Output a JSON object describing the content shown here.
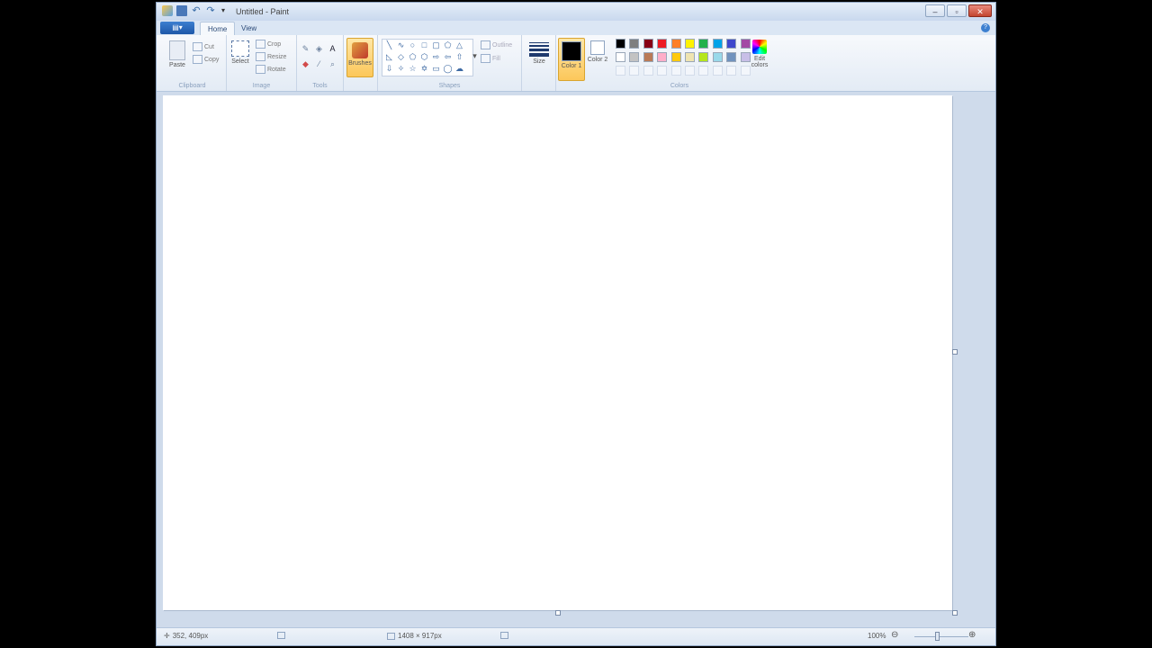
{
  "window": {
    "title": "Untitled - Paint",
    "buttons": {
      "minimize": "–",
      "maximize": "▫",
      "close": "✕"
    }
  },
  "tabs": {
    "file_icon": "▤▾",
    "home": "Home",
    "view": "View",
    "help": "?"
  },
  "ribbon": {
    "clipboard": {
      "label": "Clipboard",
      "paste": "Paste",
      "cut": "Cut",
      "copy": "Copy"
    },
    "image": {
      "label": "Image",
      "select": "Select",
      "crop": "Crop",
      "resize": "Resize",
      "rotate": "Rotate"
    },
    "tools": {
      "label": "Tools"
    },
    "brushes": {
      "label": "Brushes"
    },
    "shapes": {
      "label": "Shapes",
      "outline": "Outline",
      "fill": "Fill"
    },
    "size": {
      "label": "Size"
    },
    "color1": {
      "label": "Color 1",
      "color": "#000000"
    },
    "color2": {
      "label": "Color 2",
      "color": "#ffffff"
    },
    "colors": {
      "label": "Colors",
      "row1": [
        "#000000",
        "#7f7f7f",
        "#880015",
        "#ed1c24",
        "#ff7f27",
        "#fff200",
        "#22b14c",
        "#00a2e8",
        "#3f48cc",
        "#a349a4"
      ],
      "row2": [
        "#ffffff",
        "#c3c3c3",
        "#b97a57",
        "#ffaec9",
        "#ffc90e",
        "#efe4b0",
        "#b5e61d",
        "#99d9ea",
        "#7092be",
        "#c8bfe7"
      ]
    },
    "edit_colors": "Edit colors"
  },
  "status": {
    "cursor_pos": "352, 409px",
    "canvas_size": "1408 × 917px",
    "zoom": "100%",
    "zoom_out": "⊖",
    "zoom_in": "⊕"
  }
}
